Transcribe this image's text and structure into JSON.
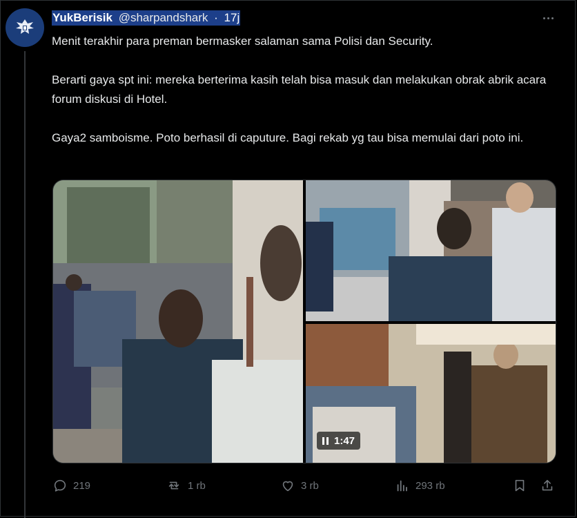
{
  "author": {
    "display_name": "YukBerisik",
    "handle": "@sharpandshark",
    "separator": "·",
    "time": "17j",
    "avatar": "garuda-emblem"
  },
  "tweet": {
    "paragraphs": [
      "Menit terakhir para preman bermasker salaman sama Polisi dan Security.",
      "Berarti gaya spt ini: mereka berterima kasih telah bisa masuk dan melakukan obrak abrik acara forum diskusi di Hotel.",
      "Gaya2 samboisme. Poto berhasil di caputure. Bagi rekab yg tau bisa memulai dari poto ini."
    ]
  },
  "media": {
    "video_duration": "1:47",
    "play_state_icon": "pause-icon"
  },
  "actions": {
    "replies": "219",
    "reposts": "1 rb",
    "likes": "3 rb",
    "views": "293 rb"
  },
  "colors": {
    "background": "#000000",
    "text": "#e7e9ea",
    "muted": "#71767b",
    "highlight": "#1d3f8a",
    "border": "#2f3336"
  }
}
